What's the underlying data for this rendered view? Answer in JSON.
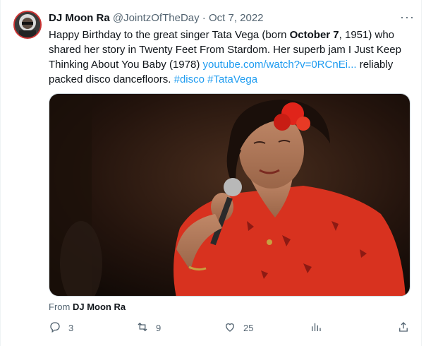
{
  "tweet": {
    "author_name": "DJ Moon Ra",
    "handle": "@JointzOfTheDay",
    "separator": "·",
    "date": "Oct 7, 2022",
    "more_label": "···",
    "text_part1": "Happy Birthday to the great singer Tata Vega (born ",
    "text_bold": "October 7",
    "text_part2": ", 1951) who shared her story in Twenty Feet From Stardom. Her superb jam I Just Keep Thinking About You Baby (1978) ",
    "link": "youtube.com/watch?v=0RCnEi...",
    "text_part3": " reliably packed disco dancefloors. ",
    "hashtag1": "#disco",
    "hashtag2": "#TataVega"
  },
  "from": {
    "prefix": "From",
    "source": "DJ Moon Ra"
  },
  "actions": {
    "reply_count": "3",
    "retweet_count": "9",
    "like_count": "25"
  },
  "colors": {
    "accent": "#1d9bf0",
    "muted": "#536471",
    "text": "#0f1419",
    "border": "#cfd9de"
  },
  "icons": [
    "more-icon",
    "reply-icon",
    "retweet-icon",
    "like-icon",
    "analytics-icon",
    "share-icon"
  ]
}
